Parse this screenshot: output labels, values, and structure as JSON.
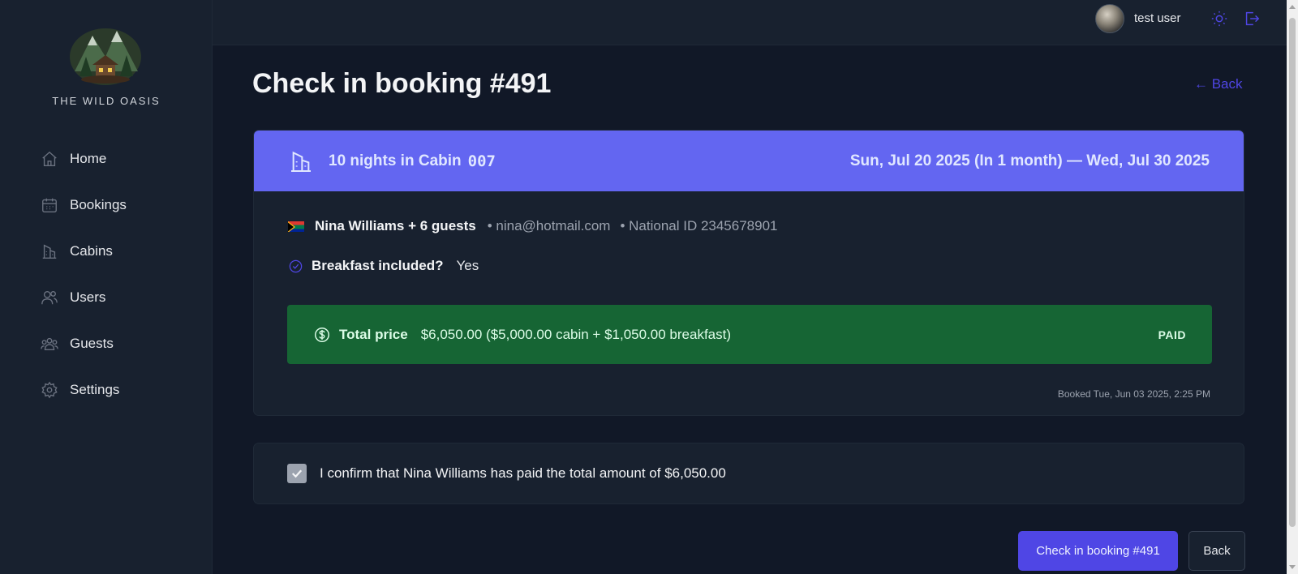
{
  "app": {
    "brand": "THE WILD OASIS",
    "accent": "#4f46e5"
  },
  "sidebar": {
    "items": [
      {
        "label": "Home",
        "icon": "home-icon"
      },
      {
        "label": "Bookings",
        "icon": "calendar-icon"
      },
      {
        "label": "Cabins",
        "icon": "building-icon"
      },
      {
        "label": "Users",
        "icon": "users-icon"
      },
      {
        "label": "Guests",
        "icon": "user-group-icon"
      },
      {
        "label": "Settings",
        "icon": "gear-icon"
      }
    ]
  },
  "header": {
    "username": "test user",
    "icons": [
      "sun-icon",
      "logout-icon"
    ]
  },
  "page": {
    "title": "Check in booking #491",
    "back_link": "← Back"
  },
  "booking": {
    "nights_label": "10 nights in Cabin",
    "cabin_code": "007",
    "dates": "Sun, Jul 20 2025 (In 1 month) — Wed, Jul 30 2025",
    "guest_name": "Nina Williams + 6 guests",
    "email": "• nina@hotmail.com",
    "national_id": "• National ID 2345678901",
    "breakfast_label": "Breakfast included?",
    "breakfast_value": "Yes",
    "price_label": "Total price",
    "price_value": "$6,050.00 ($5,000.00 cabin + $1,050.00 breakfast)",
    "status": "PAID",
    "booked_at": "Booked Tue, Jun 03 2025, 2:25 PM",
    "status_color": "#166534"
  },
  "confirm": {
    "text": "I confirm that Nina Williams has paid the total amount of $6,050.00",
    "checked": true
  },
  "actions": {
    "primary": "Check in booking #491",
    "secondary": "Back"
  }
}
